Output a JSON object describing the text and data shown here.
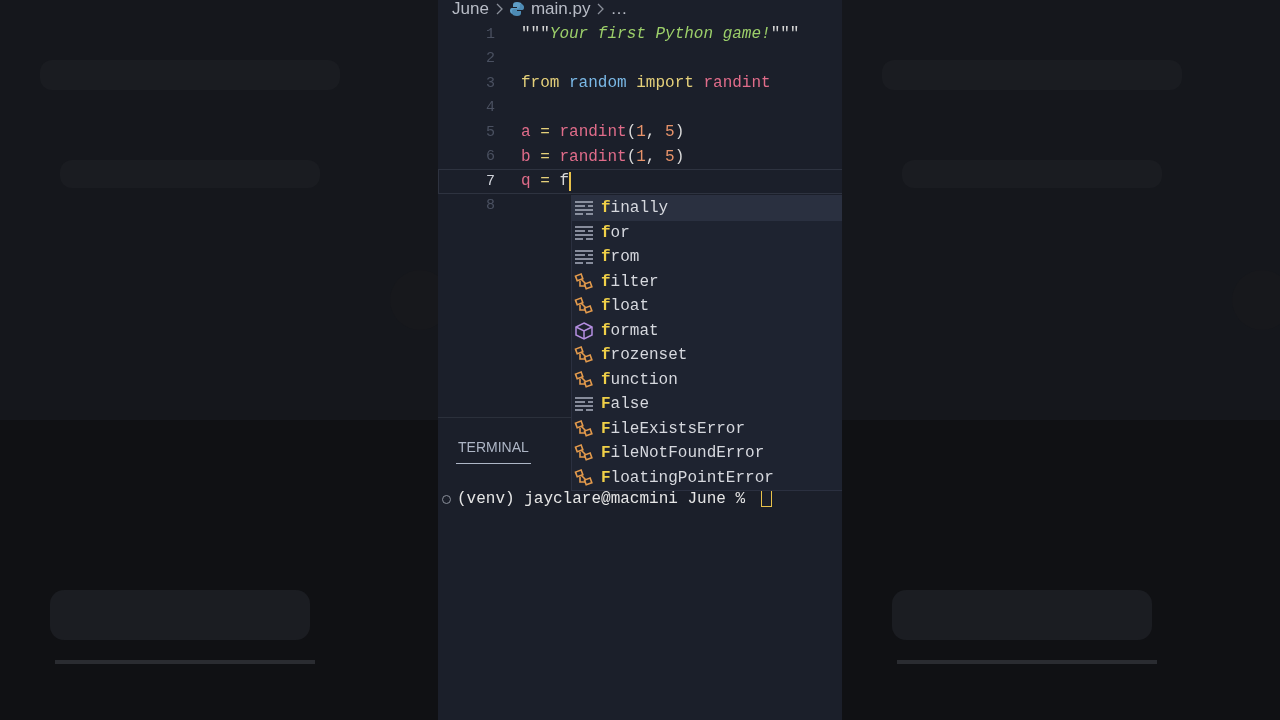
{
  "breadcrumb": {
    "folder": "June",
    "file": "main.py",
    "more": "…"
  },
  "editor": {
    "lines": [
      {
        "number": "1",
        "current": false,
        "tokens": [
          {
            "kind": "punct",
            "text": "\"\"\""
          },
          {
            "kind": "string",
            "text": "Your first Python game!"
          },
          {
            "kind": "punct",
            "text": "\"\"\""
          }
        ]
      },
      {
        "number": "2",
        "current": false
      },
      {
        "number": "3",
        "current": false,
        "tokens": [
          {
            "kind": "keyword",
            "text": "from "
          },
          {
            "kind": "module",
            "text": "random "
          },
          {
            "kind": "keyword",
            "text": "import "
          },
          {
            "kind": "func",
            "text": "randint"
          }
        ]
      },
      {
        "number": "4",
        "current": false
      },
      {
        "number": "5",
        "current": false,
        "tokens": [
          {
            "kind": "var",
            "text": "a"
          },
          {
            "kind": "op",
            "text": " = "
          },
          {
            "kind": "func",
            "text": "randint"
          },
          {
            "kind": "punct",
            "text": "("
          },
          {
            "kind": "num",
            "text": "1"
          },
          {
            "kind": "punct",
            "text": ", "
          },
          {
            "kind": "num",
            "text": "5"
          },
          {
            "kind": "punct",
            "text": ")"
          }
        ]
      },
      {
        "number": "6",
        "current": false,
        "tokens": [
          {
            "kind": "var",
            "text": "b"
          },
          {
            "kind": "op",
            "text": " = "
          },
          {
            "kind": "func",
            "text": "randint"
          },
          {
            "kind": "punct",
            "text": "("
          },
          {
            "kind": "num",
            "text": "1"
          },
          {
            "kind": "punct",
            "text": ", "
          },
          {
            "kind": "num",
            "text": "5"
          },
          {
            "kind": "punct",
            "text": ")"
          }
        ]
      },
      {
        "number": "7",
        "current": true,
        "tokens": [
          {
            "kind": "var",
            "text": "q"
          },
          {
            "kind": "op",
            "text": " = "
          },
          {
            "kind": "plain",
            "text": "f"
          }
        ]
      },
      {
        "number": "8",
        "current": false
      }
    ]
  },
  "suggestions": [
    {
      "kind": "keyword",
      "match": "f",
      "rest": "inally",
      "selected": true
    },
    {
      "kind": "keyword",
      "match": "f",
      "rest": "or",
      "selected": false
    },
    {
      "kind": "keyword",
      "match": "f",
      "rest": "rom",
      "selected": false
    },
    {
      "kind": "function",
      "match": "f",
      "rest": "ilter",
      "selected": false
    },
    {
      "kind": "function",
      "match": "f",
      "rest": "loat",
      "selected": false
    },
    {
      "kind": "class",
      "match": "f",
      "rest": "ormat",
      "selected": false
    },
    {
      "kind": "function",
      "match": "f",
      "rest": "rozenset",
      "selected": false
    },
    {
      "kind": "function",
      "match": "f",
      "rest": "unction",
      "selected": false
    },
    {
      "kind": "keyword",
      "match": "F",
      "rest": "alse",
      "selected": false
    },
    {
      "kind": "function",
      "match": "F",
      "rest": "ileExistsError",
      "selected": false
    },
    {
      "kind": "function",
      "match": "F",
      "rest": "ileNotFoundError",
      "selected": false
    },
    {
      "kind": "function",
      "match": "F",
      "rest": "loatingPointError",
      "selected": false
    }
  ],
  "panel": {
    "tabs": [
      {
        "label": "TERMINAL",
        "selected": true
      }
    ],
    "prompt": "(venv) jayclare@macmini June % "
  }
}
